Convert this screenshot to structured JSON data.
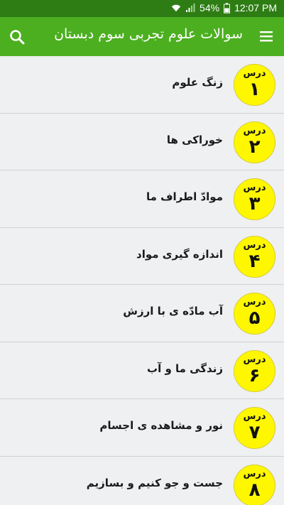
{
  "status_bar": {
    "battery": "54%",
    "time": "12:07 PM"
  },
  "app_bar": {
    "title": "سوالات علوم تجربی سوم دبستان",
    "menu_icon": "hamburger-menu-icon",
    "search_icon": "search-icon"
  },
  "colors": {
    "status_bar": "#2e7d14",
    "app_bar": "#4caf20",
    "badge": "#fff700",
    "background": "#eef0f1"
  },
  "lessons": [
    {
      "badge_label": "درس",
      "number": "۱",
      "title": "زنگ علوم"
    },
    {
      "badge_label": "درس",
      "number": "۲",
      "title": "خوراکی ها"
    },
    {
      "badge_label": "درس",
      "number": "۳",
      "title": "موادّ اطراف ما"
    },
    {
      "badge_label": "درس",
      "number": "۴",
      "title": "اندازه گیری مواد"
    },
    {
      "badge_label": "درس",
      "number": "۵",
      "title": "آب مادّه ی با ارزش"
    },
    {
      "badge_label": "درس",
      "number": "۶",
      "title": "زندگی ما و آب"
    },
    {
      "badge_label": "درس",
      "number": "۷",
      "title": "نور و مشاهده ی اجسام"
    },
    {
      "badge_label": "درس",
      "number": "۸",
      "title": "جست و جو کنیم و بسازیم"
    }
  ]
}
